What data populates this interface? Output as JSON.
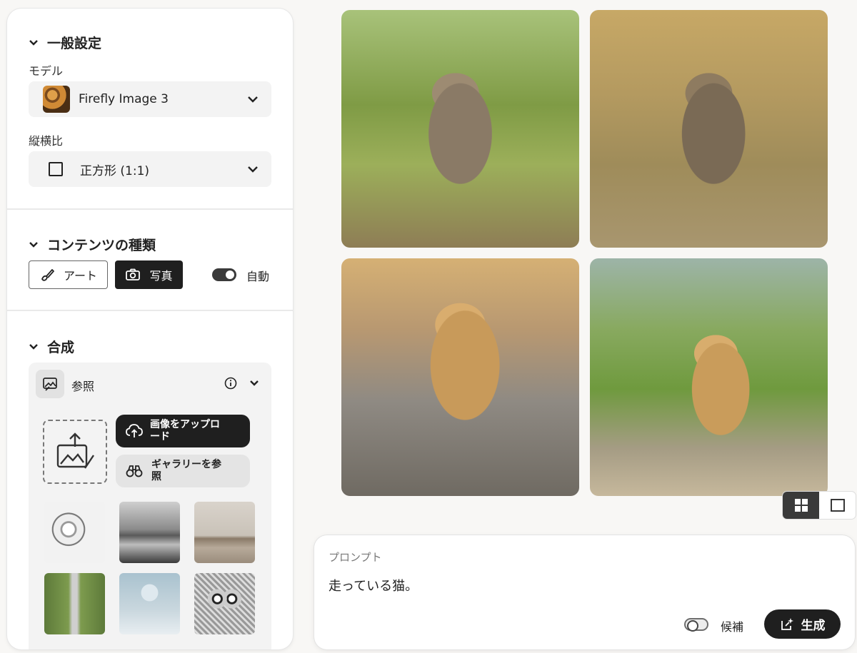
{
  "general": {
    "title": "一般設定",
    "model_label": "モデル",
    "model_value": "Firefly Image 3",
    "aspect_label": "縦横比",
    "aspect_value": "正方形 (1:1)"
  },
  "content_type": {
    "title": "コンテンツの種類",
    "art_label": "アート",
    "photo_label": "写真",
    "auto_label": "自動",
    "auto_on": true,
    "selected": "photo"
  },
  "composition": {
    "title": "合成",
    "reference_label": "参照",
    "upload_label": "画像をアップロード",
    "gallery_label": "ギャラリーを参照",
    "thumbnails": [
      "bird-sketch",
      "misty-mountains",
      "living-room",
      "rural-road",
      "sphere-on-cube",
      "owl-sketch"
    ]
  },
  "results": {
    "images": [
      "cat-running-1",
      "cat-running-2",
      "cat-running-3",
      "cat-running-4"
    ],
    "view_mode": "grid"
  },
  "prompt": {
    "label": "プロンプト",
    "text": "走っている猫。",
    "suggest_label": "候補",
    "suggest_on": false,
    "generate_label": "生成"
  },
  "colors": {
    "accent_dark": "#1f1f1f",
    "panel_bg": "#ffffff",
    "page_bg": "#f8f7f5"
  }
}
